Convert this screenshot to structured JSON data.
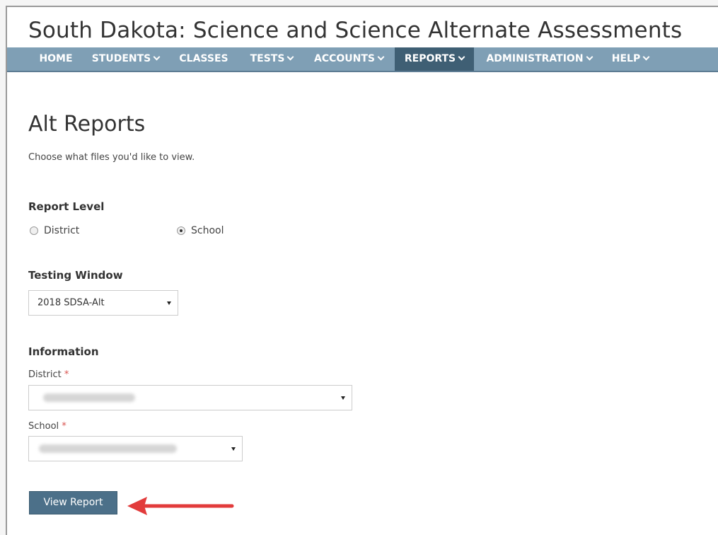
{
  "header": {
    "title": "South Dakota: Science and Science Alternate Assessments"
  },
  "nav": {
    "items": [
      {
        "label": "HOME",
        "has_dropdown": false
      },
      {
        "label": "STUDENTS",
        "has_dropdown": true
      },
      {
        "label": "CLASSES",
        "has_dropdown": false
      },
      {
        "label": "TESTS",
        "has_dropdown": true
      },
      {
        "label": "ACCOUNTS",
        "has_dropdown": true
      },
      {
        "label": "REPORTS",
        "has_dropdown": true,
        "active": true
      },
      {
        "label": "ADMINISTRATION",
        "has_dropdown": true
      },
      {
        "label": "HELP",
        "has_dropdown": true
      }
    ]
  },
  "page": {
    "heading": "Alt Reports",
    "intro": "Choose what files you'd like to view."
  },
  "report_level": {
    "label": "Report Level",
    "options": [
      {
        "label": "District",
        "selected": false
      },
      {
        "label": "School",
        "selected": true
      }
    ]
  },
  "testing_window": {
    "label": "Testing Window",
    "selected": "2018 SDSA-Alt"
  },
  "information": {
    "label": "Information",
    "district_label": "District",
    "school_label": "School",
    "required_marker": "*"
  },
  "actions": {
    "view_report_label": "View Report"
  },
  "colors": {
    "nav_bg": "#7f9fb5",
    "nav_active": "#3f5f74",
    "button_bg": "#4c7089",
    "required": "#d9534f",
    "annotation_arrow": "#e23b3b"
  },
  "icons": {
    "dropdown": "chevron-down-icon",
    "select_caret": "caret-down-icon",
    "annotation": "red-arrow-icon"
  }
}
